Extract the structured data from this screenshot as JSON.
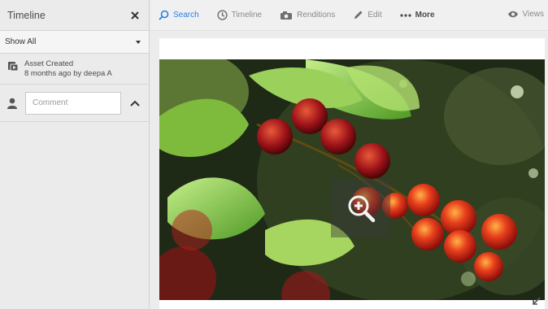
{
  "sidebar": {
    "title": "Timeline",
    "filter": {
      "selected": "Show All"
    },
    "events": [
      {
        "title": "Asset Created",
        "meta": "8 months ago by deepa A"
      }
    ],
    "comment": {
      "placeholder": "Comment"
    }
  },
  "toolbar": {
    "items": [
      {
        "label": "Search",
        "icon": "search-icon",
        "active": true
      },
      {
        "label": "Timeline",
        "icon": "clock-icon"
      },
      {
        "label": "Renditions",
        "icon": "renditions-icon"
      },
      {
        "label": "Edit",
        "icon": "pencil-icon"
      },
      {
        "label": "More",
        "icon": "more-icon"
      }
    ],
    "views_label": "Views"
  },
  "colors": {
    "accent": "#2680eb",
    "sidebar_bg": "#ebebeb",
    "toolbar_bg": "#f0f0f0"
  }
}
